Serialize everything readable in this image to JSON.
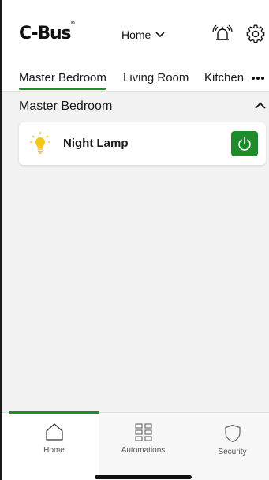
{
  "header": {
    "logo_text": "C-Bus",
    "logo_mark": "®",
    "home_selector": "Home"
  },
  "tabs": [
    {
      "label": "Master Bedroom",
      "active": true
    },
    {
      "label": "Living Room",
      "active": false
    },
    {
      "label": "Kitchen",
      "active": false
    }
  ],
  "room": {
    "title": "Master Bedroom"
  },
  "devices": [
    {
      "name": "Night Lamp",
      "icon": "bulb-icon",
      "power": "on"
    }
  ],
  "bottom_nav": [
    {
      "label": "Home",
      "icon": "home-icon",
      "active": true
    },
    {
      "label": "Automations",
      "icon": "grid-icon",
      "active": false
    },
    {
      "label": "Security",
      "icon": "shield-icon",
      "active": false
    }
  ],
  "colors": {
    "accent": "#1e8b2c",
    "bulb": "#f5c518"
  }
}
